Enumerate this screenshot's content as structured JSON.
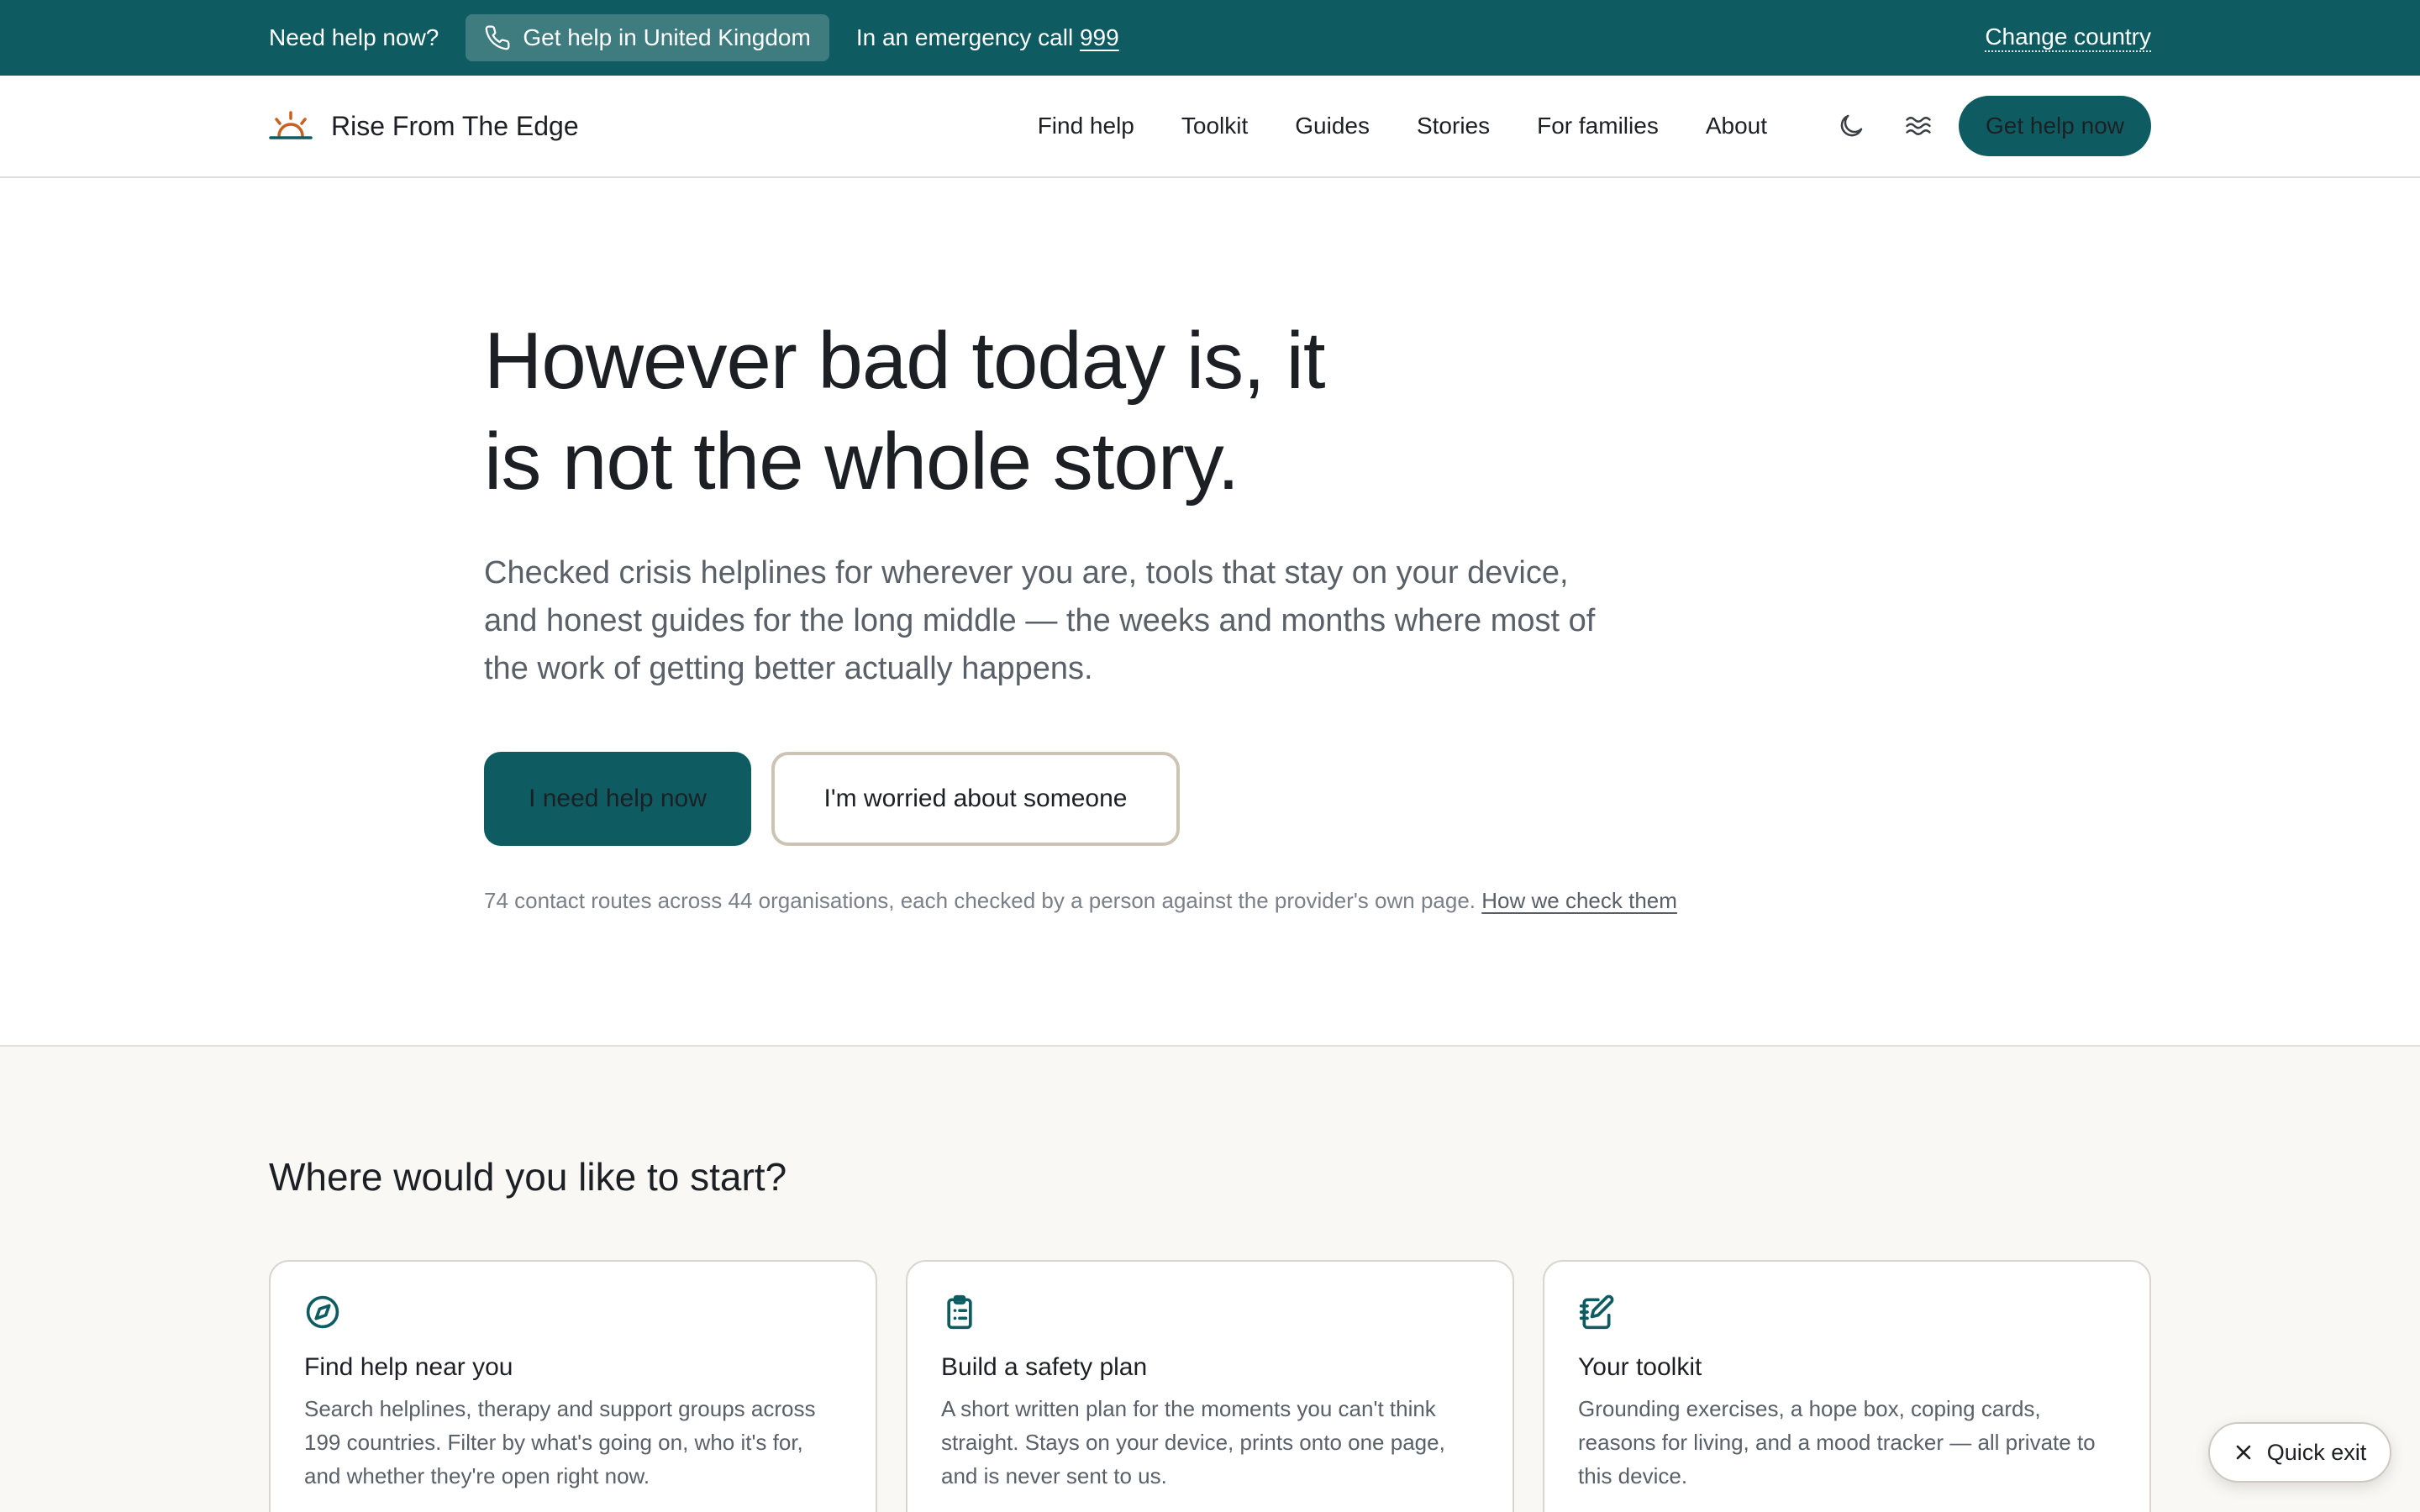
{
  "topbar": {
    "need_help": "Need help now?",
    "help_button": "Get help in United Kingdom",
    "emergency_prefix": "In an emergency call",
    "emergency_number": "999",
    "change_country": "Change country"
  },
  "header": {
    "brand": "Rise From The Edge",
    "nav": [
      "Find help",
      "Toolkit",
      "Guides",
      "Stories",
      "For families",
      "About"
    ],
    "cta": "Get help now"
  },
  "hero": {
    "title_line1": "However bad today is, it",
    "title_line2": "is not the whole story.",
    "subtitle": "Checked crisis helplines for wherever you are, tools that stay on your device, and honest guides for the long middle — the weeks and months where most of the work of getting better actually happens.",
    "primary_button": "I need help now",
    "secondary_button": "I'm worried about someone",
    "note": "74 contact routes across 44 organisations, each checked by a person against the provider's own page.",
    "note_link": "How we check them"
  },
  "start": {
    "title": "Where would you like to start?",
    "cards": [
      {
        "icon": "compass-icon",
        "title": "Find help near you",
        "desc": "Search helplines, therapy and support groups across 199 countries. Filter by what's going on, who it's for, and whether they're open right now."
      },
      {
        "icon": "clipboard-icon",
        "title": "Build a safety plan",
        "desc": "A short written plan for the moments you can't think straight. Stays on your device, prints onto one page, and is never sent to us."
      },
      {
        "icon": "notebook-pen-icon",
        "title": "Your toolkit",
        "desc": "Grounding exercises, a hope box, coping cards, reasons for living, and a mood tracker — all private to this device."
      }
    ]
  },
  "quick_exit": {
    "label": "Quick exit"
  },
  "colors": {
    "brand_teal": "#0e5c61",
    "sunrise_orange": "#c8601e",
    "section_bg": "#f9f8f5"
  }
}
